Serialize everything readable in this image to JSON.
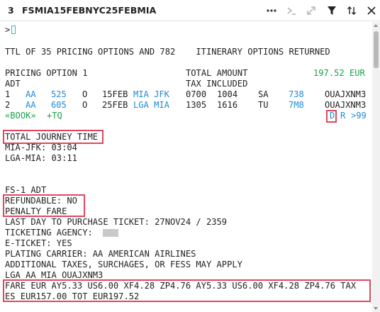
{
  "window": {
    "number": "3",
    "command": "FSMIA15FEBNYC25FEBMIA"
  },
  "icons": {
    "toolbar": [
      "more-icon",
      "command-prompt-icon",
      "expand-icon",
      "filter-icon",
      "sort-icon",
      "close-icon"
    ],
    "colors": {
      "link": "#1f8bd6",
      "price": "#1aa148",
      "highlight": "#e0475f",
      "cursor": "#35b7c9"
    }
  },
  "terminal": {
    "prompt": ">",
    "summary": "TTL OF 35 PRICING OPTIONS AND 782    ITINERARY OPTIONS RETURNED",
    "pricing_option": "PRICING OPTION 1",
    "total_amount_label": "TOTAL AMOUNT",
    "total_amount": "197.52 EUR",
    "pax_type": "ADT",
    "tax_included": "TAX INCLUDED",
    "segments": [
      {
        "num": "1",
        "airline": "AA",
        "flight": "525",
        "class": "O",
        "date": "15FEB",
        "route": "MIA JFK",
        "dep": "0700",
        "arr": "1004",
        "day": "SA",
        "equipment": "738",
        "fare_basis": "OUAJXNM3"
      },
      {
        "num": "2",
        "airline": "AA",
        "flight": "605",
        "class": "O",
        "date": "25FEB",
        "route": "LGA MIA",
        "dep": "1305",
        "arr": "1616",
        "day": "TU",
        "equipment": "7M8",
        "fare_basis": "OUAJXNM3"
      }
    ],
    "actions": {
      "book": "«BOOK»",
      "tq": "+TQ",
      "d": "D",
      "r": "R",
      "more": ">99"
    },
    "journey_time_title": "TOTAL JOURNEY TIME",
    "journey_times": [
      "MIA-JFK: 03:04",
      "LGA-MIA: 03:11"
    ],
    "fare_section": "FS-1 ADT",
    "refundable": "REFUNDABLE: NO",
    "penalty": "PENALTY FARE",
    "last_day": "LAST DAY TO PURCHASE TICKET: 27NOV24 / 2359",
    "agency_label": "TICKETING AGENCY:",
    "eticket": "E-TICKET: YES",
    "plating": "PLATING CARRIER: AA AMERICAN AIRLINES",
    "additional": "ADDITIONAL TAXES, SURCHAGES, OR FESS MAY APPLY",
    "fare_calc": "LGA AA MIA OUAJXNM3",
    "fare_line1": "FARE EUR AY5.33 US6.00 XF4.28 ZP4.76 AY5.33 US6.00 XF4.28 ZP4.76 TAX",
    "fare_line2": "ES EUR157.00 TOT EUR197.52"
  }
}
